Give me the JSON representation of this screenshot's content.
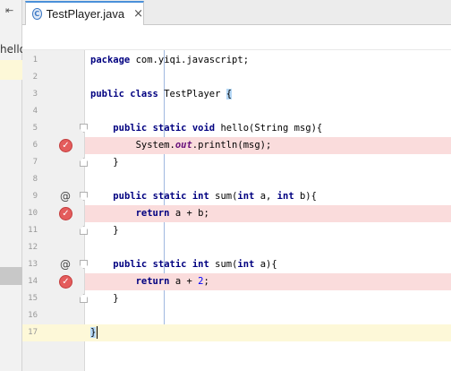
{
  "left_panel": {
    "collapse_glyph": "⇤",
    "partial_label": "hello"
  },
  "tab": {
    "class_icon_letter": "C",
    "label": "TestPlayer.java",
    "close_glyph": "×"
  },
  "editor": {
    "lines": [
      {
        "n": "1",
        "text": "package com.yiqi.javascript;",
        "marker": ""
      },
      {
        "n": "2",
        "text": "",
        "marker": ""
      },
      {
        "n": "3",
        "text": "public class TestPlayer {",
        "marker": ""
      },
      {
        "n": "4",
        "text": "",
        "marker": ""
      },
      {
        "n": "5",
        "text": "    public static void hello(String msg){",
        "marker": ""
      },
      {
        "n": "6",
        "text": "        System.out.println(msg);",
        "marker": "breakpoint"
      },
      {
        "n": "7",
        "text": "    }",
        "marker": ""
      },
      {
        "n": "8",
        "text": "",
        "marker": ""
      },
      {
        "n": "9",
        "text": "    public static int sum(int a, int b){",
        "marker": "override"
      },
      {
        "n": "10",
        "text": "        return a + b;",
        "marker": "breakpoint"
      },
      {
        "n": "11",
        "text": "    }",
        "marker": ""
      },
      {
        "n": "12",
        "text": "",
        "marker": ""
      },
      {
        "n": "13",
        "text": "    public static int sum(int a){",
        "marker": "override"
      },
      {
        "n": "14",
        "text": "        return a + 2;",
        "marker": "breakpoint"
      },
      {
        "n": "15",
        "text": "    }",
        "marker": ""
      },
      {
        "n": "16",
        "text": "",
        "marker": ""
      },
      {
        "n": "17",
        "text": "}",
        "marker": ""
      }
    ],
    "current_line": "17",
    "override_glyph": "@",
    "breakpoint_glyph": "✓"
  }
}
